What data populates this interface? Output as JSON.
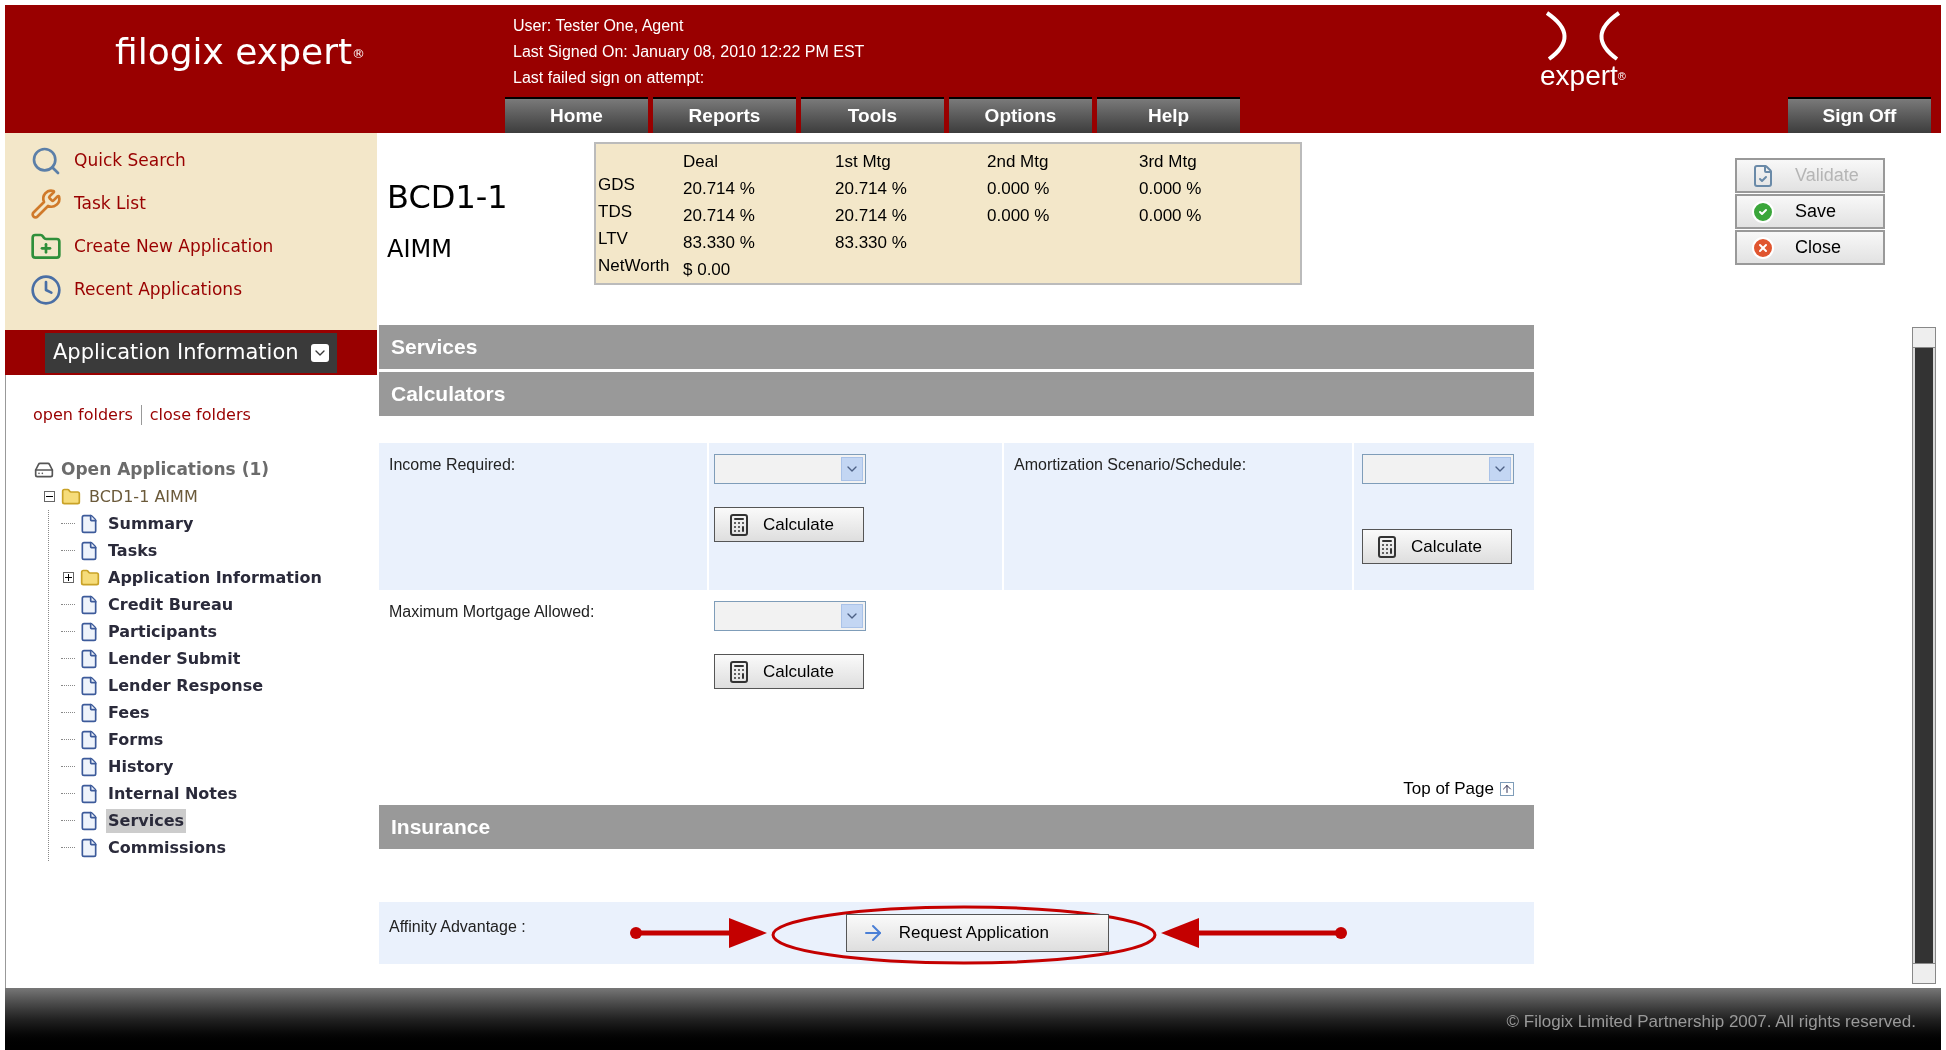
{
  "header": {
    "logo": "filogix expert",
    "logo_mark": "®",
    "user": "User: Tester One, Agent",
    "last_signed": "Last Signed On: January 08, 2010 12:22 PM EST",
    "last_failed": "Last failed sign on attempt:",
    "brand": "expert",
    "brand_mark": "®"
  },
  "nav": [
    "Home",
    "Reports",
    "Tools",
    "Options",
    "Help"
  ],
  "sign_off": "Sign Off",
  "quick_links": [
    {
      "label": "Quick Search",
      "kind": "search"
    },
    {
      "label": "Task List",
      "kind": "tasks"
    },
    {
      "label": "Create New Application",
      "kind": "create"
    },
    {
      "label": "Recent Applications",
      "kind": "recent"
    }
  ],
  "panel_title": "Application Information",
  "folder_links": [
    "open folders",
    "close folders"
  ],
  "tree": {
    "label": "Open Applications (1)",
    "children": [
      {
        "label": "BCD1-1 AIMM",
        "kind": "folder",
        "expanded": true,
        "selected": false,
        "children": [
          {
            "label": "Summary",
            "kind": "page",
            "selected": false
          },
          {
            "label": "Tasks",
            "kind": "page",
            "selected": false
          },
          {
            "label": "Application Information",
            "kind": "folder",
            "expanded": false,
            "selected": false
          },
          {
            "label": "Credit Bureau",
            "kind": "page",
            "selected": false
          },
          {
            "label": "Participants",
            "kind": "page",
            "selected": false
          },
          {
            "label": "Lender Submit",
            "kind": "page",
            "selected": false
          },
          {
            "label": "Lender Response",
            "kind": "page",
            "selected": false
          },
          {
            "label": "Fees",
            "kind": "page",
            "selected": false
          },
          {
            "label": "Forms",
            "kind": "page",
            "selected": false
          },
          {
            "label": "History",
            "kind": "page",
            "selected": false
          },
          {
            "label": "Internal Notes",
            "kind": "page",
            "selected": false
          },
          {
            "label": "Services",
            "kind": "page",
            "selected": true
          },
          {
            "label": "Commissions",
            "kind": "page",
            "selected": false
          }
        ]
      }
    ]
  },
  "deal": {
    "id": "BCD1-1",
    "name": "AIMM"
  },
  "ratios": {
    "columns": [
      "Deal",
      "1st Mtg",
      "2nd Mtg",
      "3rd Mtg"
    ],
    "rows": [
      {
        "label": "GDS",
        "values": [
          "20.714 %",
          "20.714 %",
          "0.000 %",
          "0.000 %"
        ]
      },
      {
        "label": "TDS",
        "values": [
          "20.714 %",
          "20.714 %",
          "0.000 %",
          "0.000 %"
        ]
      },
      {
        "label": "LTV",
        "values": [
          "83.330 %",
          "83.330 %"
        ]
      },
      {
        "label": "NetWorth",
        "values": [
          "$ 0.00"
        ]
      }
    ]
  },
  "actions": [
    {
      "label": "Validate",
      "kind": "validate",
      "disabled": true
    },
    {
      "label": "Save",
      "kind": "save",
      "disabled": false
    },
    {
      "label": "Close",
      "kind": "close",
      "disabled": false
    }
  ],
  "sections": {
    "services": "Services",
    "calculators": "Calculators",
    "insurance": "Insurance"
  },
  "calculators": [
    {
      "label": "Income Required:",
      "button": "Calculate"
    },
    {
      "label": "Amortization Scenario/Schedule:",
      "button": "Calculate"
    },
    {
      "label": "Maximum Mortgage Allowed:",
      "button": "Calculate"
    }
  ],
  "top_of_page": "Top of Page",
  "affinity": {
    "label": "Affinity Advantage :",
    "button": "Request Application"
  },
  "footer": "© Filogix Limited Partnership 2007. All rights reserved."
}
